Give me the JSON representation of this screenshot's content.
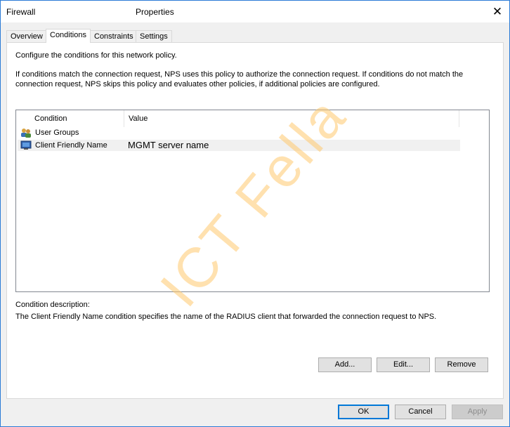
{
  "window": {
    "title_left": "Firewall",
    "title_right": "Properties",
    "close_glyph": "✕"
  },
  "tabs": [
    {
      "label": "Overview",
      "active": false
    },
    {
      "label": "Conditions",
      "active": true
    },
    {
      "label": "Constraints",
      "active": false
    },
    {
      "label": "Settings",
      "active": false
    }
  ],
  "panel": {
    "intro": "Configure the conditions for this network policy.",
    "paragraph": "If conditions match the connection request, NPS uses this policy to authorize the connection request. If conditions do not match the connection request, NPS skips this policy and evaluates other policies, if additional policies are configured.",
    "columns": {
      "condition": "Condition",
      "value": "Value"
    },
    "rows": [
      {
        "icon": "user-groups-icon",
        "condition": "User Groups",
        "value": ""
      },
      {
        "icon": "client-friendly-name-icon",
        "condition": "Client Friendly Name",
        "value": "MGMT server name",
        "selected": true
      }
    ],
    "description_label": "Condition description:",
    "description_text": "The Client Friendly Name condition specifies the name of the RADIUS client that forwarded the connection request to NPS."
  },
  "panel_buttons": {
    "add": "Add...",
    "edit": "Edit...",
    "remove": "Remove"
  },
  "dialog_buttons": {
    "ok": "OK",
    "cancel": "Cancel",
    "apply": "Apply"
  },
  "watermark": "ICT Fella",
  "colors": {
    "accent": "#0078d7",
    "watermark": "#ffc86e"
  }
}
